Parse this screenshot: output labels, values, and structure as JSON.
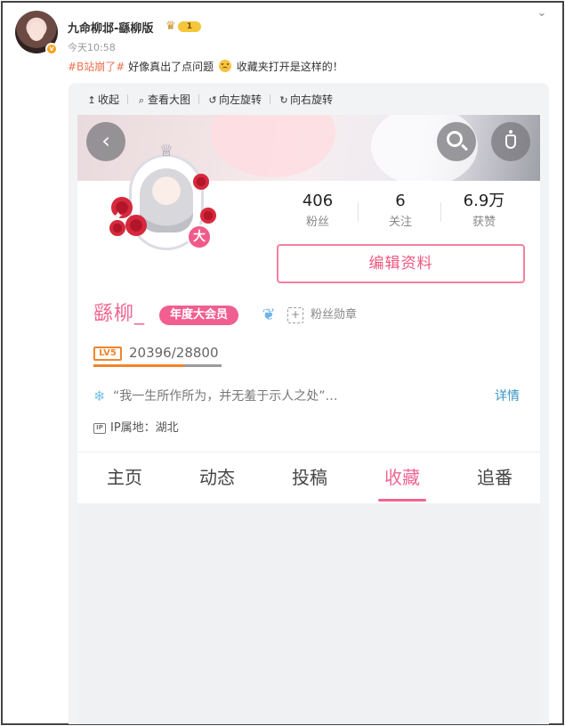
{
  "post": {
    "username": "九命柳邶-繇柳版",
    "level_badge": "1",
    "time": "今天10:58",
    "hashtag": "#B站崩了#",
    "text_before_emoji": " 好像真出了点问题 ",
    "text_after_emoji": " 收藏夹打开是这样的！"
  },
  "toolbar": {
    "collapse": "收起",
    "view_large": "查看大图",
    "rotate_left": "向左旋转",
    "rotate_right": "向右旋转"
  },
  "profile": {
    "stats": [
      {
        "value": "406",
        "label": "粉丝"
      },
      {
        "value": "6",
        "label": "关注"
      },
      {
        "value": "6.9万",
        "label": "获赞"
      }
    ],
    "edit_button": "编辑资料",
    "vip_badge_char": "大",
    "name": "繇柳_",
    "vip_tag": "年度大会员",
    "fans_medal_label": "粉丝勋章",
    "level_label": "LV5",
    "exp_text": "20396/28800",
    "exp_progress": 0.708,
    "signature": "“我一生所作所为，并无羞于示人之处”…",
    "detail_link": "详情",
    "ip_label": "IP",
    "ip_location": "IP属地：湖北"
  },
  "tabs": [
    {
      "label": "主页",
      "active": false
    },
    {
      "label": "动态",
      "active": false
    },
    {
      "label": "投稿",
      "active": false
    },
    {
      "label": "收藏",
      "active": true
    },
    {
      "label": "追番",
      "active": false
    }
  ],
  "colors": {
    "accent_pink": "#f06591",
    "hashtag_orange": "#eb7350",
    "link_blue": "#3896c4",
    "level_orange": "#f0852c"
  },
  "icons": [
    "avatar",
    "verified-badge",
    "crown-icon",
    "chevron-down-icon",
    "collapse-icon",
    "search-zoom-icon",
    "rotate-left-icon",
    "rotate-right-icon",
    "back-icon",
    "search-icon",
    "more-icon",
    "medal-icon",
    "fans-medal-icon",
    "snowflake-icon",
    "ip-icon"
  ]
}
